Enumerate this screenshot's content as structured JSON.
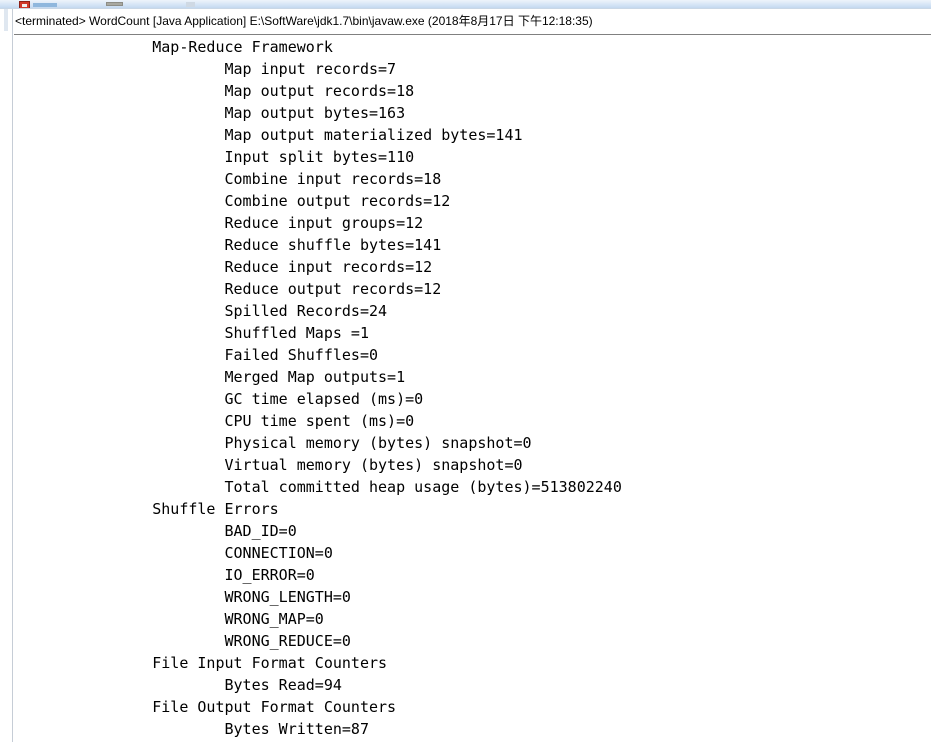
{
  "window": {
    "type": "eclipse-console-view",
    "toolbar": {
      "terminate_icon": "terminate-icon",
      "remove_launch_icon": "remove-launch-icon",
      "scroll_lock_icon": "scroll-lock-icon",
      "pin_console_icon": "pin-console-icon"
    }
  },
  "console": {
    "launch_header": "<terminated> WordCount [Java Application] E:\\SoftWare\\jdk1.7\\bin\\javaw.exe (2018年8月17日 下午12:18:35)",
    "launch_status": "<terminated>",
    "launch_config_name": "WordCount",
    "launch_type": "[Java Application]",
    "launch_vm_path": "E:\\SoftWare\\jdk1.7\\bin\\javaw.exe",
    "launch_timestamp": "(2018年8月17日 下午12:18:35)",
    "lines": [
      "        Map-Reduce Framework",
      "                Map input records=7",
      "                Map output records=18",
      "                Map output bytes=163",
      "                Map output materialized bytes=141",
      "                Input split bytes=110",
      "                Combine input records=18",
      "                Combine output records=12",
      "                Reduce input groups=12",
      "                Reduce shuffle bytes=141",
      "                Reduce input records=12",
      "                Reduce output records=12",
      "                Spilled Records=24",
      "                Shuffled Maps =1",
      "                Failed Shuffles=0",
      "                Merged Map outputs=1",
      "                GC time elapsed (ms)=0",
      "                CPU time spent (ms)=0",
      "                Physical memory (bytes) snapshot=0",
      "                Virtual memory (bytes) snapshot=0",
      "                Total committed heap usage (bytes)=513802240",
      "        Shuffle Errors",
      "                BAD_ID=0",
      "                CONNECTION=0",
      "                IO_ERROR=0",
      "                WRONG_LENGTH=0",
      "                WRONG_MAP=0",
      "                WRONG_REDUCE=0",
      "        File Input Format Counters ",
      "                Bytes Read=94",
      "        File Output Format Counters ",
      "                Bytes Written=87"
    ],
    "counter_groups": [
      {
        "name": "Map-Reduce Framework",
        "counters": [
          {
            "name": "Map input records",
            "value": "7"
          },
          {
            "name": "Map output records",
            "value": "18"
          },
          {
            "name": "Map output bytes",
            "value": "163"
          },
          {
            "name": "Map output materialized bytes",
            "value": "141"
          },
          {
            "name": "Input split bytes",
            "value": "110"
          },
          {
            "name": "Combine input records",
            "value": "18"
          },
          {
            "name": "Combine output records",
            "value": "12"
          },
          {
            "name": "Reduce input groups",
            "value": "12"
          },
          {
            "name": "Reduce shuffle bytes",
            "value": "141"
          },
          {
            "name": "Reduce input records",
            "value": "12"
          },
          {
            "name": "Reduce output records",
            "value": "12"
          },
          {
            "name": "Spilled Records",
            "value": "24"
          },
          {
            "name": "Shuffled Maps ",
            "value": "1"
          },
          {
            "name": "Failed Shuffles",
            "value": "0"
          },
          {
            "name": "Merged Map outputs",
            "value": "1"
          },
          {
            "name": "GC time elapsed (ms)",
            "value": "0"
          },
          {
            "name": "CPU time spent (ms)",
            "value": "0"
          },
          {
            "name": "Physical memory (bytes) snapshot",
            "value": "0"
          },
          {
            "name": "Virtual memory (bytes) snapshot",
            "value": "0"
          },
          {
            "name": "Total committed heap usage (bytes)",
            "value": "513802240"
          }
        ]
      },
      {
        "name": "Shuffle Errors",
        "counters": [
          {
            "name": "BAD_ID",
            "value": "0"
          },
          {
            "name": "CONNECTION",
            "value": "0"
          },
          {
            "name": "IO_ERROR",
            "value": "0"
          },
          {
            "name": "WRONG_LENGTH",
            "value": "0"
          },
          {
            "name": "WRONG_MAP",
            "value": "0"
          },
          {
            "name": "WRONG_REDUCE",
            "value": "0"
          }
        ]
      },
      {
        "name": "File Input Format Counters ",
        "counters": [
          {
            "name": "Bytes Read",
            "value": "94"
          }
        ]
      },
      {
        "name": "File Output Format Counters ",
        "counters": [
          {
            "name": "Bytes Written",
            "value": "87"
          }
        ]
      }
    ]
  },
  "colors": {
    "console_background": "#ffffff",
    "console_text": "#000000",
    "header_rule": "#808080",
    "toolbar_top": "#eef4fb",
    "toolbar_bottom": "#c3d8ef",
    "terminate_red": "#d0392b",
    "gutter_border": "#c6cdd6"
  }
}
